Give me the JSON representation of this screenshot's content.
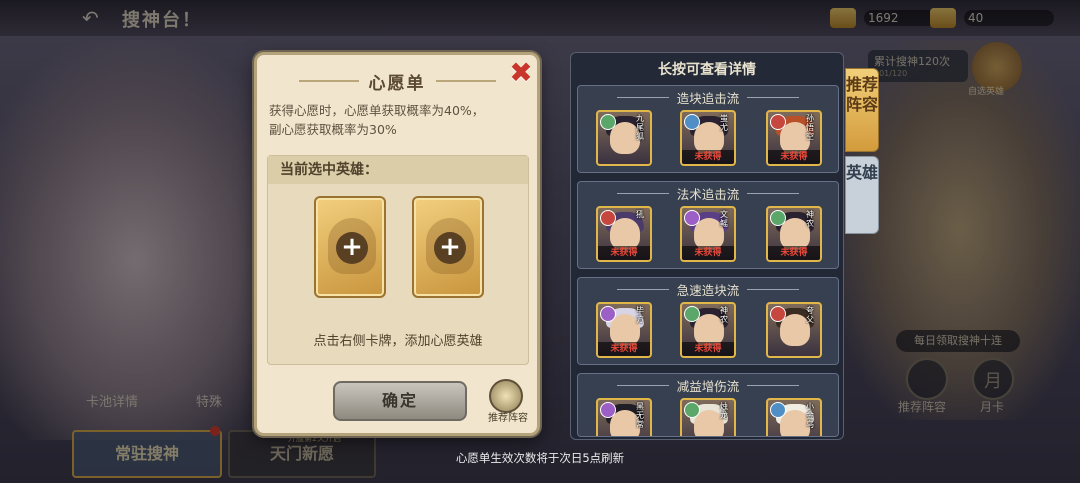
{
  "header": {
    "title": "搜神台！",
    "currency_1": "1692",
    "currency_2": "40"
  },
  "background": {
    "summon_count": "累计搜神120次",
    "summon_sub": "101/120",
    "summon_badge_label": "自选英雄",
    "daily_pill": "每日领取搜神十连",
    "recommend_team_label": "推荐阵容",
    "monthly_card_label": "月卡",
    "monthly_card_glyph": "月",
    "pool_detail_link": "卡池详情",
    "special_link": "特殊",
    "tab_permanent": "常驻搜神",
    "tab_tianmen": "天门新愿",
    "tab_tianmen_sub": "一开服第2天开启"
  },
  "dialog": {
    "title": "心愿单",
    "desc_line1": "获得心愿时，心愿单获取概率为40%，",
    "desc_line2": "副心愿获取概率为30%",
    "selected_heading": "当前选中英雄：",
    "hint": "点击右侧卡牌，添加心愿英雄",
    "confirm": "确定",
    "recommend_label": "推荐阵容"
  },
  "panel": {
    "title": "长按可查看详情",
    "teams": [
      {
        "name": "造块追击流",
        "heroes": [
          {
            "name": "九尾狐",
            "faction": "f-green",
            "status": ""
          },
          {
            "name": "蚩尤",
            "faction": "f-blue",
            "status": "未获得"
          },
          {
            "name": "孙悟空",
            "faction": "f-red",
            "status": "未获得"
          }
        ]
      },
      {
        "name": "法术追击流",
        "heroes": [
          {
            "name": "犼",
            "faction": "f-red",
            "status": "未获得"
          },
          {
            "name": "文鳐",
            "faction": "f-purple",
            "status": "未获得"
          },
          {
            "name": "神农",
            "faction": "f-green",
            "status": "未获得"
          }
        ]
      },
      {
        "name": "急速造块流",
        "heroes": [
          {
            "name": "毕方",
            "faction": "f-purple",
            "status": "未获得"
          },
          {
            "name": "神农",
            "faction": "f-green",
            "status": "未获得"
          },
          {
            "name": "夸父",
            "faction": "f-red",
            "status": ""
          }
        ]
      },
      {
        "name": "减益增伤流",
        "heroes": [
          {
            "name": "黑无常",
            "faction": "f-purple",
            "status": ""
          },
          {
            "name": "烛龙",
            "faction": "f-green",
            "status": ""
          },
          {
            "name": "小金乌",
            "faction": "f-blue",
            "status": ""
          }
        ]
      }
    ]
  },
  "side_tabs": {
    "recommend": "推荐阵容",
    "hero": "英雄"
  },
  "notice": "心愿单生效次数将于次日5点刷新"
}
